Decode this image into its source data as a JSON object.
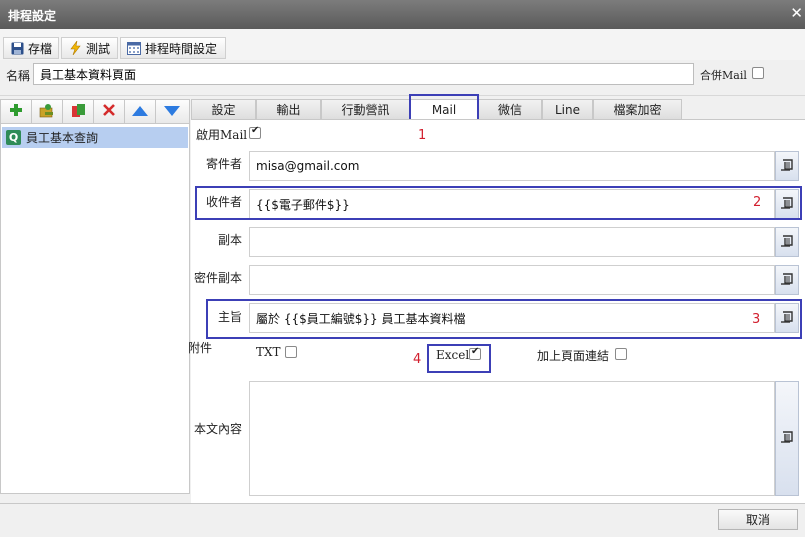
{
  "window": {
    "title": "排程設定"
  },
  "toolbar": {
    "save_label": "存檔",
    "test_label": "測試",
    "schedule_time_label": "排程時間設定"
  },
  "name": {
    "label": "名稱",
    "value": "員工基本資料頁面"
  },
  "merge_mail": {
    "label": "合併Mail",
    "checked": false
  },
  "tree": {
    "items": [
      {
        "label": "員工基本查詢"
      }
    ]
  },
  "tabs": [
    {
      "label": "設定",
      "active": false
    },
    {
      "label": "輸出",
      "active": false
    },
    {
      "label": "行動營訊",
      "active": false
    },
    {
      "label": "Mail",
      "active": true
    },
    {
      "label": "微信",
      "active": false
    },
    {
      "label": "Line",
      "active": false
    },
    {
      "label": "檔案加密",
      "active": false
    }
  ],
  "mail": {
    "enable_label": "啟用Mail",
    "enable_checked": true,
    "sender_label": "寄件者",
    "sender_value": "misa@gmail.com",
    "recipient_label": "收件者",
    "recipient_value": "{{$電子郵件$}}",
    "cc_label": "副本",
    "cc_value": "",
    "bcc_label": "密件副本",
    "bcc_value": "",
    "subject_label": "主旨",
    "subject_value": "屬於 {{$員工編號$}} 員工基本資料檔",
    "attachment_label": "附件",
    "txt_label": "TXT",
    "txt_checked": false,
    "excel_label": "Excel",
    "excel_checked": true,
    "page_link_label": "加上頁面連結",
    "page_link_checked": false,
    "body_label": "本文內容",
    "body_value": ""
  },
  "annotations": {
    "n1": "1",
    "n2": "2",
    "n3": "3",
    "n4": "4"
  },
  "footer": {
    "cancel_label": "取消"
  },
  "colors": {
    "highlight": "#3c3fb6",
    "annotation_red": "#d21f2e",
    "selected_row": "#b7cef0"
  }
}
